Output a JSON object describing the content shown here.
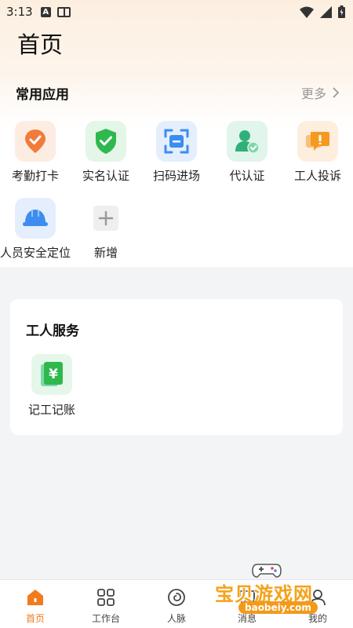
{
  "status_bar": {
    "time": "3:13"
  },
  "page": {
    "title": "首页"
  },
  "common_apps": {
    "title": "常用应用",
    "more_label": "更多",
    "items": [
      {
        "label": "考勤打卡",
        "icon": "attendance-check-icon",
        "color": "#f07c3a"
      },
      {
        "label": "实名认证",
        "icon": "shield-check-icon",
        "color": "#2fb84e"
      },
      {
        "label": "扫码进场",
        "icon": "scan-qr-icon",
        "color": "#3d8cf0"
      },
      {
        "label": "代认证",
        "icon": "proxy-verify-user-icon",
        "color": "#2fb07a"
      },
      {
        "label": "工人投诉",
        "icon": "complaint-chat-icon",
        "color": "#f59a1f"
      },
      {
        "label": "人员安全定位",
        "icon": "safety-helmet-icon",
        "color": "#3d8cf0"
      },
      {
        "label": "新增",
        "icon": "plus-icon",
        "color": "#999999"
      }
    ]
  },
  "worker_service": {
    "title": "工人服务",
    "items": [
      {
        "label": "记工记账",
        "icon": "yuan-ledger-icon",
        "color": "#2fb84e"
      }
    ]
  },
  "tabbar": {
    "accent": "#f07c1e",
    "tabs": [
      {
        "label": "首页",
        "icon": "home-icon",
        "active": true
      },
      {
        "label": "工作台",
        "icon": "workbench-grid-icon",
        "active": false
      },
      {
        "label": "人脉",
        "icon": "contacts-swirl-icon",
        "active": false
      },
      {
        "label": "消息",
        "icon": "message-icon",
        "active": false
      },
      {
        "label": "我的",
        "icon": "profile-icon",
        "active": false
      }
    ]
  },
  "watermark": {
    "text": "宝贝游戏网",
    "url": "baobeiy.com"
  }
}
